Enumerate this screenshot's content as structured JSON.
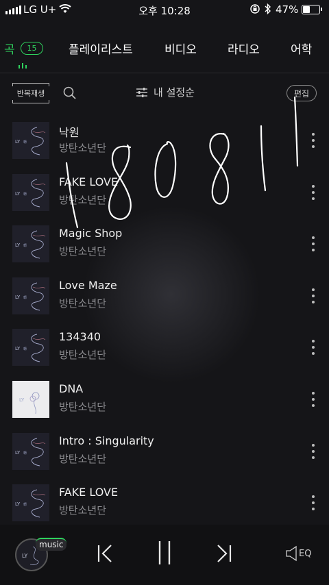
{
  "status_bar": {
    "carrier": "LG U+",
    "time": "오후 10:28",
    "battery": "47%",
    "battery_level": 0.47
  },
  "tabs": [
    {
      "label": "곡",
      "count": "15",
      "active": true
    },
    {
      "label": "플레이리스트"
    },
    {
      "label": "비디오"
    },
    {
      "label": "라디오"
    },
    {
      "label": "어학"
    }
  ],
  "toolbar": {
    "repeat_label": "반복재생",
    "settings_label": "내 설정순",
    "edit_label": "편집"
  },
  "songs": [
    {
      "title": "낙원",
      "artist": "방탄소년단",
      "art": "dark"
    },
    {
      "title": "FAKE LOVE",
      "artist": "방탄소년단",
      "art": "dark"
    },
    {
      "title": "Magic Shop",
      "artist": "방탄소년단",
      "art": "dark"
    },
    {
      "title": "Love Maze",
      "artist": "방탄소년단",
      "art": "dark"
    },
    {
      "title": "134340",
      "artist": "방탄소년단",
      "art": "dark"
    },
    {
      "title": "DNA",
      "artist": "방탄소년단",
      "art": "light"
    },
    {
      "title": "Intro : Singularity",
      "artist": "방탄소년단",
      "art": "dark"
    },
    {
      "title": "FAKE LOVE",
      "artist": "방탄소년단",
      "art": "dark"
    }
  ],
  "handwriting": "180811",
  "player": {
    "badge": "music",
    "eq_label": "EQ"
  },
  "colors": {
    "accent": "#2fd25e",
    "background": "#151518"
  },
  "icons": [
    "search-icon",
    "sliders-icon",
    "more-vertical-icon",
    "previous-icon",
    "pause-icon",
    "next-icon",
    "speaker-icon",
    "wifi-icon",
    "bluetooth-icon",
    "rotation-lock-icon"
  ]
}
